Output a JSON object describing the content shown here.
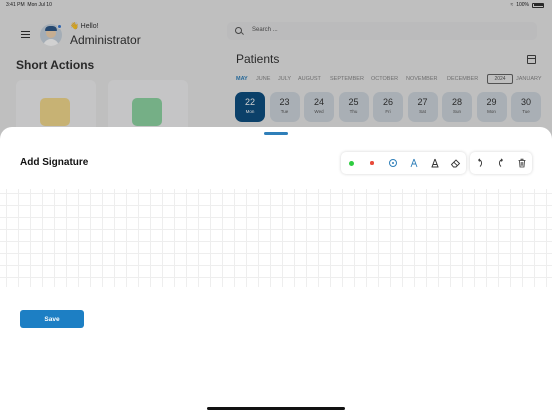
{
  "status_bar": {
    "time": "3:41 PM",
    "date": "Mon Jul 10",
    "battery": "100%"
  },
  "header": {
    "greeting": "Hello!",
    "user_name": "Administrator"
  },
  "short_actions": {
    "title": "Short Actions"
  },
  "search": {
    "placeholder": "Search ..."
  },
  "patients": {
    "title": "Patients",
    "months": [
      "MAY",
      "JUNE",
      "JULY",
      "AUGUST",
      "SEPTEMBER",
      "OCTOBER",
      "NOVEMBER",
      "DECEMBER",
      "2024",
      "JANUARY"
    ],
    "selected_month": "MAY",
    "days": [
      {
        "num": "22",
        "wd": "Mon",
        "selected": true
      },
      {
        "num": "23",
        "wd": "Tue"
      },
      {
        "num": "24",
        "wd": "Wed"
      },
      {
        "num": "25",
        "wd": "Thu"
      },
      {
        "num": "26",
        "wd": "Fri"
      },
      {
        "num": "27",
        "wd": "Sat"
      },
      {
        "num": "28",
        "wd": "Sun"
      },
      {
        "num": "29",
        "wd": "Mon"
      },
      {
        "num": "30",
        "wd": "Tue"
      }
    ]
  },
  "sheet": {
    "title": "Add Signature",
    "save_label": "Save"
  },
  "colors": {
    "accent": "#1d7fc4",
    "selected_day": "#0e4f80",
    "green_pen": "#2ecc40",
    "red_pen": "#e84a3b"
  }
}
